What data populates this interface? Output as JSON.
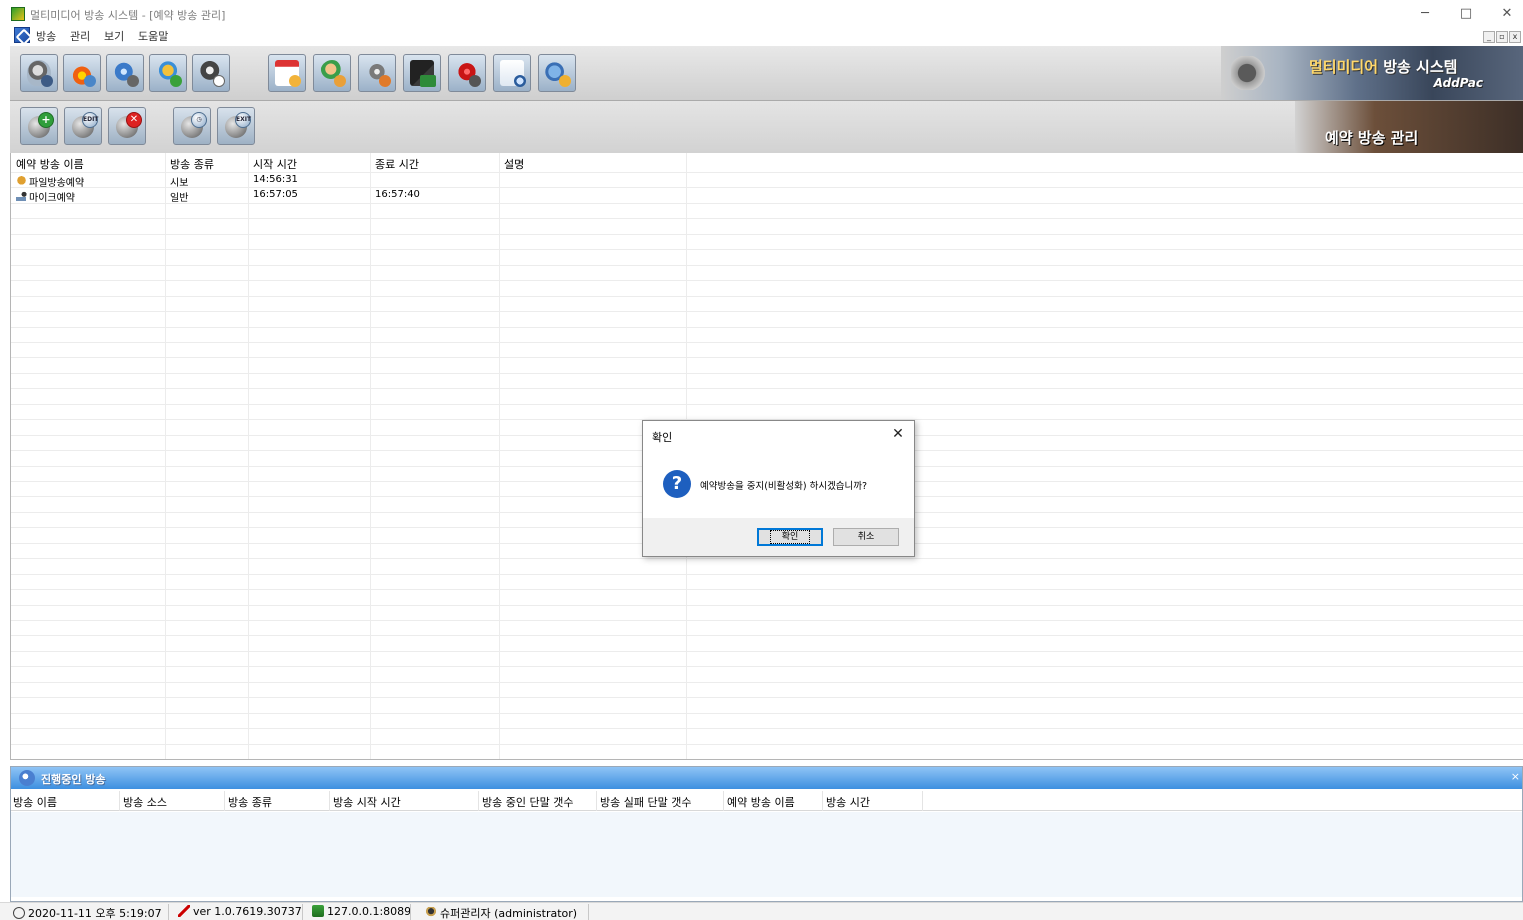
{
  "window": {
    "title": "멀티미디어 방송 시스템 - [예약 방송 관리]",
    "controls": {
      "minimize": "─",
      "maximize": "□",
      "close": "✕"
    }
  },
  "menu": {
    "items": [
      "방송",
      "관리",
      "보기",
      "도움말"
    ],
    "mdi_controls": [
      "_",
      "▫",
      "x"
    ]
  },
  "banner": {
    "title_part1": "멀티미디어",
    "title_part2": " 방송 시스템",
    "subtitle": "AddPac",
    "section_label": "예약 방송 관리"
  },
  "toolbar_main": {
    "buttons": [
      {
        "name": "broadcast-main-button",
        "icon": "speaker-icon"
      },
      {
        "name": "fire-alarm-button",
        "icon": "fire-icon"
      },
      {
        "name": "network-broadcast-button",
        "icon": "globe-icon"
      },
      {
        "name": "group-broadcast-button",
        "icon": "group-icon"
      },
      {
        "name": "mic-schedule-button",
        "icon": "mic-clock-icon"
      },
      {
        "name": "schedule-calendar-button",
        "icon": "calendar-icon"
      },
      {
        "name": "user-voice-button",
        "icon": "user-voice-icon"
      },
      {
        "name": "settings-button",
        "icon": "gear-icon"
      },
      {
        "name": "dns-button",
        "icon": "dns-icon"
      },
      {
        "name": "emergency-119-button",
        "icon": "emergency-icon"
      },
      {
        "name": "search-log-button",
        "icon": "search-icon"
      },
      {
        "name": "config-tool-button",
        "icon": "tool-icon"
      }
    ]
  },
  "toolbar_sub": {
    "buttons": [
      {
        "name": "add-schedule-button",
        "icon": "mic-add-icon",
        "badge": "+"
      },
      {
        "name": "edit-schedule-button",
        "icon": "mic-edit-icon",
        "badge": "EDIT"
      },
      {
        "name": "delete-schedule-button",
        "icon": "mic-delete-icon",
        "badge": "✕"
      },
      {
        "name": "schedule-time-button",
        "icon": "mic-clock-icon",
        "badge": "◷"
      },
      {
        "name": "schedule-exit-button",
        "icon": "mic-exit-icon",
        "badge": "EXIT"
      }
    ]
  },
  "schedule_list": {
    "columns": [
      "예약 방송 이름",
      "방송 종류",
      "시작 시간",
      "종료 시간",
      "설명"
    ],
    "rows": [
      {
        "name": "파일방송예약",
        "type": "시보",
        "start": "14:56:31",
        "end": "",
        "desc": "",
        "icon": "file-broadcast-icon"
      },
      {
        "name": "마이크예약",
        "type": "일반",
        "start": "16:57:05",
        "end": "16:57:40",
        "desc": "",
        "icon": "mic-broadcast-icon"
      }
    ]
  },
  "dialog": {
    "title": "확인",
    "message": "예약방송을 중지(비활성화) 하시겠습니까?",
    "ok": "확인",
    "cancel": "취소",
    "close": "✕",
    "icon": "?"
  },
  "progress_panel": {
    "title": "진행중인 방송",
    "close": "×",
    "columns": [
      "방송 이름",
      "방송 소스",
      "방송 종류",
      "방송 시작 시간",
      "방송 중인 단말 갯수",
      "방송 실패 단말 갯수",
      "예약 방송 이름",
      "방송 시간"
    ]
  },
  "statusbar": {
    "datetime": "2020-11-11 오후 5:19:07",
    "version": "ver 1.0.7619.30737",
    "address": "127.0.0.1:8089",
    "user": "슈퍼관리자 (administrator)"
  }
}
